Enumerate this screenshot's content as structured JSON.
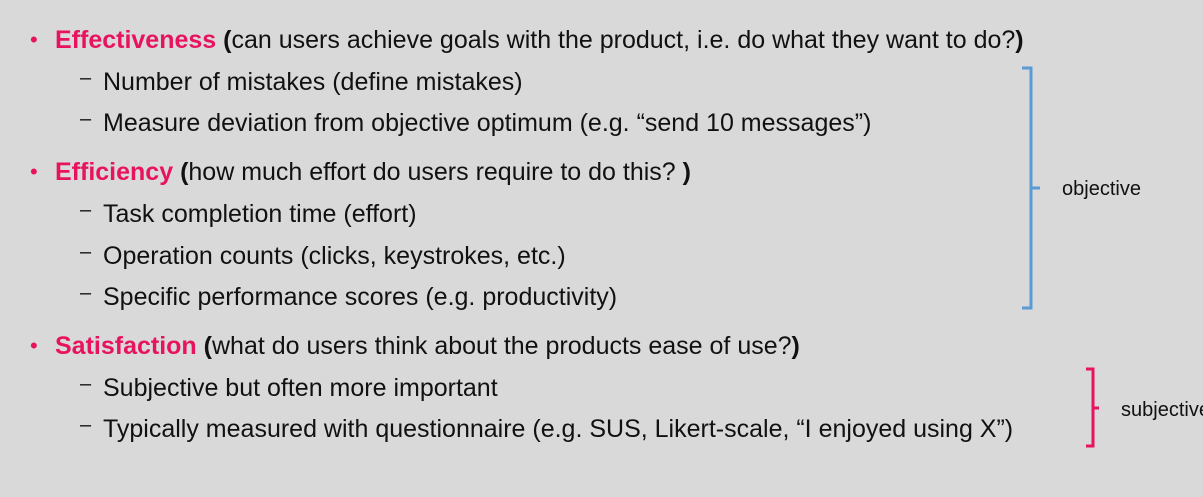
{
  "sections": [
    {
      "term": "Effectiveness",
      "open": "(",
      "desc": "can users achieve goals with the product, i.e. do what they want to do?",
      "close": ")",
      "items": [
        "Number of mistakes (define mistakes)",
        "Measure deviation from objective optimum (e.g. “send 10 messages”)"
      ]
    },
    {
      "term": "Efficiency",
      "open": "(",
      "desc": "how much effort do users require to do this? ",
      "close": ")",
      "items": [
        "Task completion time (effort)",
        "Operation counts (clicks, keystrokes, etc.)",
        "Specific performance scores (e.g. productivity)"
      ]
    },
    {
      "term": "Satisfaction",
      "open": "(",
      "desc": "what do users think about the products ease of use?",
      "close": ")",
      "items": [
        "Subjective but often more important",
        "Typically measured with questionnaire (e.g. SUS, Likert-scale, “I enjoyed using X”)"
      ]
    }
  ],
  "brackets": {
    "objective": {
      "label": "objective",
      "color": "#5b9bd5"
    },
    "subjective": {
      "label": "subjective",
      "color": "#e8135e"
    }
  },
  "glyphs": {
    "bullet": "•",
    "dash": "–"
  },
  "colors": {
    "background": "#d9d9d9",
    "accent": "#e8135e"
  }
}
